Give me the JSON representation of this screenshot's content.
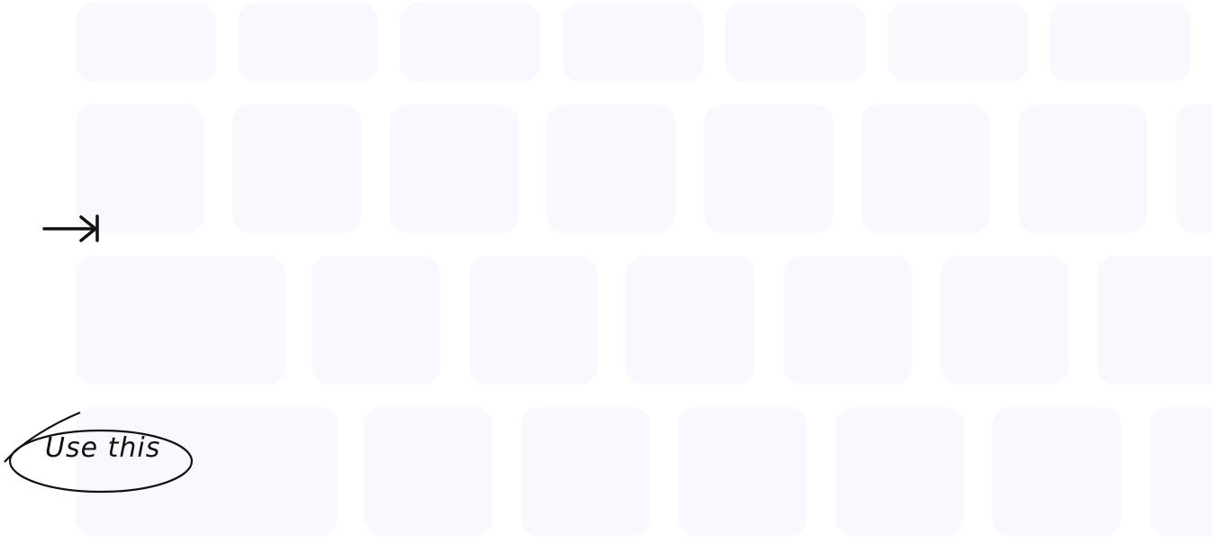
{
  "annotation": {
    "label": "Use this",
    "icon": "tab-arrow-icon"
  },
  "colors": {
    "key": "#f8f9fe",
    "ink": "#111111"
  }
}
